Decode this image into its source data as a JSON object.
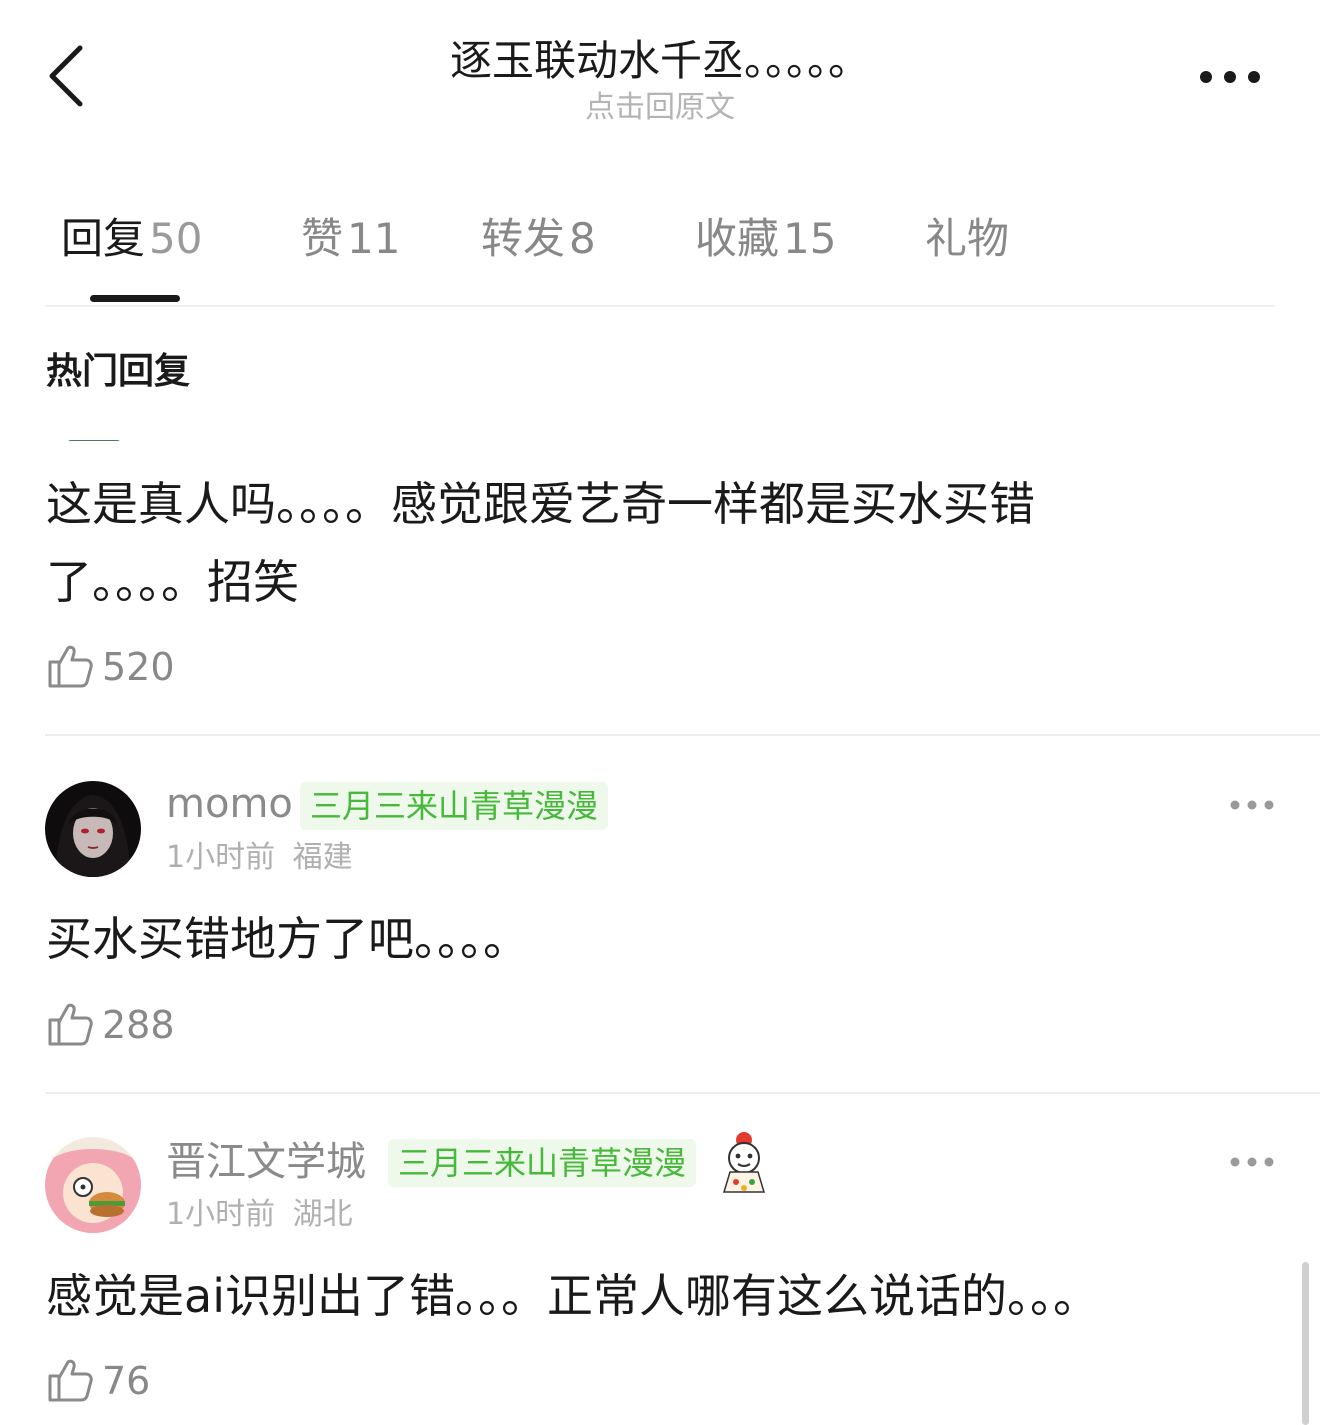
{
  "header": {
    "title": "逐玉联动水千丞。。。。。",
    "subtitle": "点击回原文",
    "back_icon": "chevron-left-icon",
    "more_icon": "more-horizontal-icon"
  },
  "tabs": [
    {
      "label": "回复",
      "count": "50",
      "active": true
    },
    {
      "label": "赞",
      "count": "11",
      "active": false
    },
    {
      "label": "转发",
      "count": "8",
      "active": false
    },
    {
      "label": "收藏",
      "count": "15",
      "active": false
    },
    {
      "label": "礼物",
      "count": "",
      "active": false
    }
  ],
  "section_title": "热门回复",
  "comments": [
    {
      "text_line1": "这是真人吗。。。。感觉跟爱艺奇一样都是买水买错",
      "text_line2": "了。。。。招笑",
      "likes": "520"
    },
    {
      "username": "momo",
      "badge": "三月三来山青草漫漫",
      "time": "1小时前",
      "location": "福建",
      "text": "买水买错地方了吧。。。。",
      "likes": "288"
    },
    {
      "username": "晋江文学城",
      "badge": "三月三来山青草漫漫",
      "time": "1小时前",
      "location": "湖北",
      "text": "感觉是ai识别出了错。。。正常人哪有这么说话的。。。",
      "likes": "76"
    }
  ],
  "colors": {
    "text_primary": "#1a1a1a",
    "text_secondary": "#888888",
    "badge_bg": "#eef9ec",
    "badge_text": "#46b83a"
  }
}
